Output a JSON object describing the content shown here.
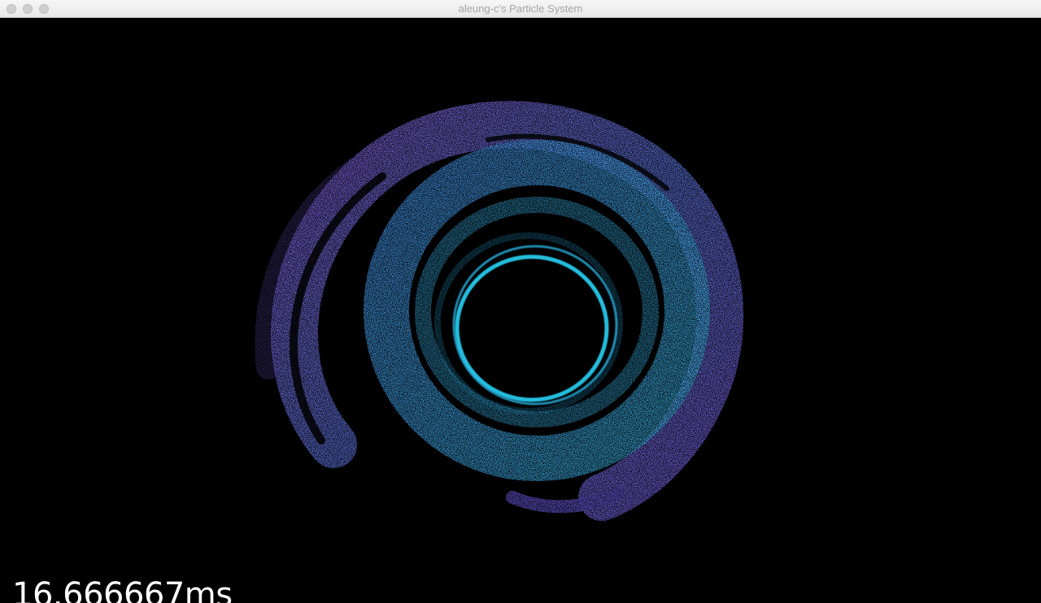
{
  "window": {
    "title": "aleung-c's Particle System",
    "buttons": [
      "close",
      "minimize",
      "zoom"
    ]
  },
  "viewport": {
    "background": "#000000",
    "particle_colors": {
      "outer": "#8a6cff",
      "middle": "#5a8cff",
      "inner": "#2ad0f0"
    }
  },
  "overlay": {
    "frame_time": "16.666667ms"
  }
}
